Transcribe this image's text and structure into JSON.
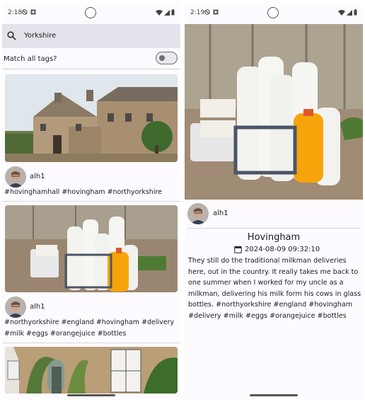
{
  "left": {
    "status": {
      "time": "2:18"
    },
    "search": {
      "query": "Yorkshire"
    },
    "match_tags_label": "Match all tags?",
    "posts": [
      {
        "user": "alh1",
        "tags": "#hovinghamhall #hovingham #northyorkshire"
      },
      {
        "user": "alh1",
        "tags_line1": "#northyorkshire #england #hovingham #delivery",
        "tags_line2": "#milk #eggs #orangejuice #bottles"
      }
    ]
  },
  "right": {
    "status": {
      "time": "2:19"
    },
    "user": "alh1",
    "title": "Hovingham",
    "date": "2024-08-09 09:32:10",
    "body": "They still do the traditional milkman deliveries here, out in the country. It really takes me back to one summer when I worked for my uncle as a milkman, delivering his milk form his cows in glass bottles. #northyorkshire #england #hovingham #delivery #milk #eggs #orangejuice #bottles"
  },
  "icons": {
    "search": "search-icon",
    "calendar": "calendar-icon",
    "wifi": "wifi-icon",
    "signal": "signal-icon",
    "battery": "battery-icon"
  },
  "colors": {
    "search_bar": "#e4e3eb",
    "background": "#fdfbff",
    "juice": "#f5a50a"
  }
}
